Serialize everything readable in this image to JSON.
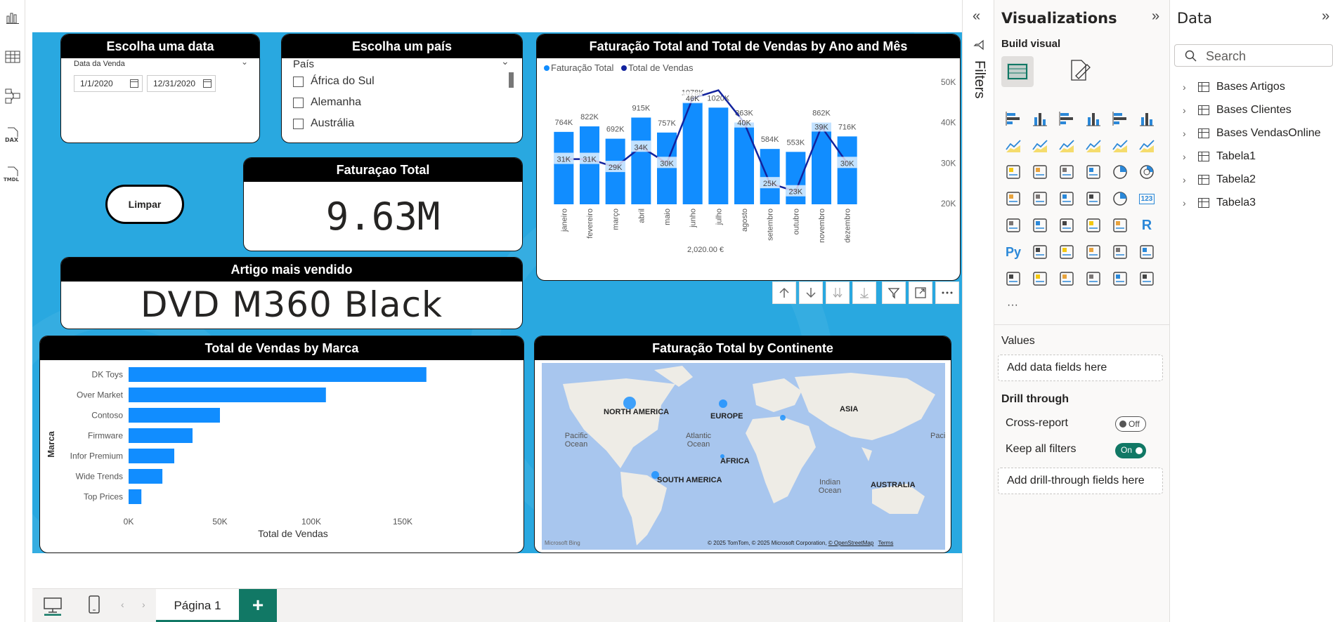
{
  "colors": {
    "report_bg": "#29a8e0",
    "bar": "#118dff",
    "line": "#12239e",
    "accent_green": "#117865"
  },
  "left_rail": {
    "icons": [
      "report-view-icon",
      "table-view-icon",
      "model-view-icon",
      "dax-query-icon",
      "tmdl-view-icon"
    ],
    "dax": "DAX",
    "tmdl": "TMDL"
  },
  "slicer_date": {
    "title": "Escolha uma data",
    "field": "Data da Venda",
    "start": "1/1/2020",
    "end": "12/31/2020"
  },
  "slicer_country": {
    "title": "Escolha um país",
    "field": "País",
    "items": [
      "África do Sul",
      "Alemanha",
      "Austrália"
    ]
  },
  "kpi": {
    "title": "Faturaçao Total",
    "value": "9.63M"
  },
  "limpar": {
    "label": "Limpar"
  },
  "artigo": {
    "title": "Artigo mais vendido",
    "value": "DVD M360 Black"
  },
  "combo_chart": {
    "title": "Faturação Total and Total de Vendas by Ano and Mês",
    "legend": [
      "Faturação Total",
      "Total de Vendas"
    ],
    "footer": "2,020.00 €"
  },
  "marca_chart": {
    "title": "Total de Vendas by Marca",
    "ylabel": "Marca",
    "xlabel": "Total de Vendas",
    "ticks": [
      "0K",
      "50K",
      "100K",
      "150K"
    ]
  },
  "map": {
    "title": "Faturação Total by Continente",
    "labels": [
      "NORTH AMERICA",
      "EUROPE",
      "ASIA",
      "AFRICA",
      "SOUTH AMERICA",
      "AUSTRALIA"
    ],
    "oceans": [
      "Pacific Ocean",
      "Atlantic Ocean",
      "Indian Ocean",
      "Pacific Oce"
    ],
    "bing": "Microsoft Bing",
    "copyright": "© 2025 TomTom, © 2025 Microsoft Corporation,",
    "osm": "© OpenStreetMap",
    "terms": "Terms"
  },
  "tabs": {
    "page": "Página 1",
    "add": "+"
  },
  "filters": {
    "label": "Filters"
  },
  "viz": {
    "title": "Visualizations",
    "build": "Build visual",
    "grid_icons": [
      "stacked-bar",
      "stacked-column",
      "clustered-bar",
      "clustered-column",
      "100-bar",
      "100-column",
      "line",
      "area",
      "stacked-area",
      "100-area",
      "line-column",
      "line-clustered",
      "ribbon",
      "waterfall",
      "funnel",
      "scatter",
      "pie",
      "donut",
      "treemap",
      "map",
      "filled-map",
      "azure-map",
      "gauge",
      "card",
      "multi-row-card",
      "kpi",
      "slicer",
      "table",
      "matrix",
      "r-visual",
      "python-visual",
      "key-influencers",
      "decomposition-tree",
      "qa",
      "smart-narrative",
      "metrics",
      "paginated",
      "power-apps",
      "power-automate",
      "arcgis",
      "diamond",
      "chevron"
    ],
    "grid_text": {
      "card": "123",
      "r": "R",
      "py": "Py"
    },
    "more": "···",
    "values": "Values",
    "add_data": "Add data fields here",
    "drill": "Drill through",
    "cross_report": "Cross-report",
    "off": "Off",
    "keep_filters": "Keep all filters",
    "on": "On",
    "add_drill": "Add drill-through fields here"
  },
  "data_pane": {
    "title": "Data",
    "search_placeholder": "Search",
    "tables": [
      "Bases Artigos",
      "Bases Clientes",
      "Bases VendasOnline",
      "Tabela1",
      "Tabela2",
      "Tabela3"
    ]
  },
  "chart_data": [
    {
      "type": "bar",
      "title": "Faturação Total and Total de Vendas by Ano and Mês",
      "categories": [
        "janeiro",
        "fevereiro",
        "março",
        "abril",
        "maio",
        "junho",
        "julho",
        "agosto",
        "setembro",
        "outubro",
        "novembro",
        "dezembro"
      ],
      "series": [
        {
          "name": "Faturação Total",
          "type": "bar",
          "values": [
            764,
            822,
            692,
            915,
            757,
            1078,
            1020,
            863,
            584,
            553,
            862,
            716
          ],
          "labels": [
            "764K",
            "822K",
            "692K",
            "915K",
            "757K",
            "1078K",
            "1020K",
            "863K",
            "584K",
            "553K",
            "862K",
            "716K"
          ]
        },
        {
          "name": "Total de Vendas",
          "type": "line",
          "values": [
            31,
            31,
            29,
            34,
            30,
            46,
            48,
            40,
            25,
            23,
            39,
            30
          ],
          "labels": [
            "31K",
            "31K",
            "29K",
            "34K",
            "30K",
            "46K",
            "",
            "40K",
            "25K",
            "23K",
            "39K",
            "30K"
          ]
        }
      ],
      "y2_ticks": [
        "50K",
        "40K",
        "30K",
        "20K"
      ],
      "xlabel": "2,020.00 €"
    },
    {
      "type": "bar",
      "title": "Total de Vendas by Marca",
      "categories": [
        "DK Toys",
        "Over Market",
        "Contoso",
        "Firmware",
        "Infor Premium",
        "Wide Trends",
        "Top Prices"
      ],
      "values": [
        163000,
        108000,
        50000,
        35000,
        25000,
        18500,
        7000
      ],
      "xlim": [
        0,
        175000
      ],
      "xlabel": "Total de Vendas",
      "ylabel": "Marca"
    }
  ]
}
